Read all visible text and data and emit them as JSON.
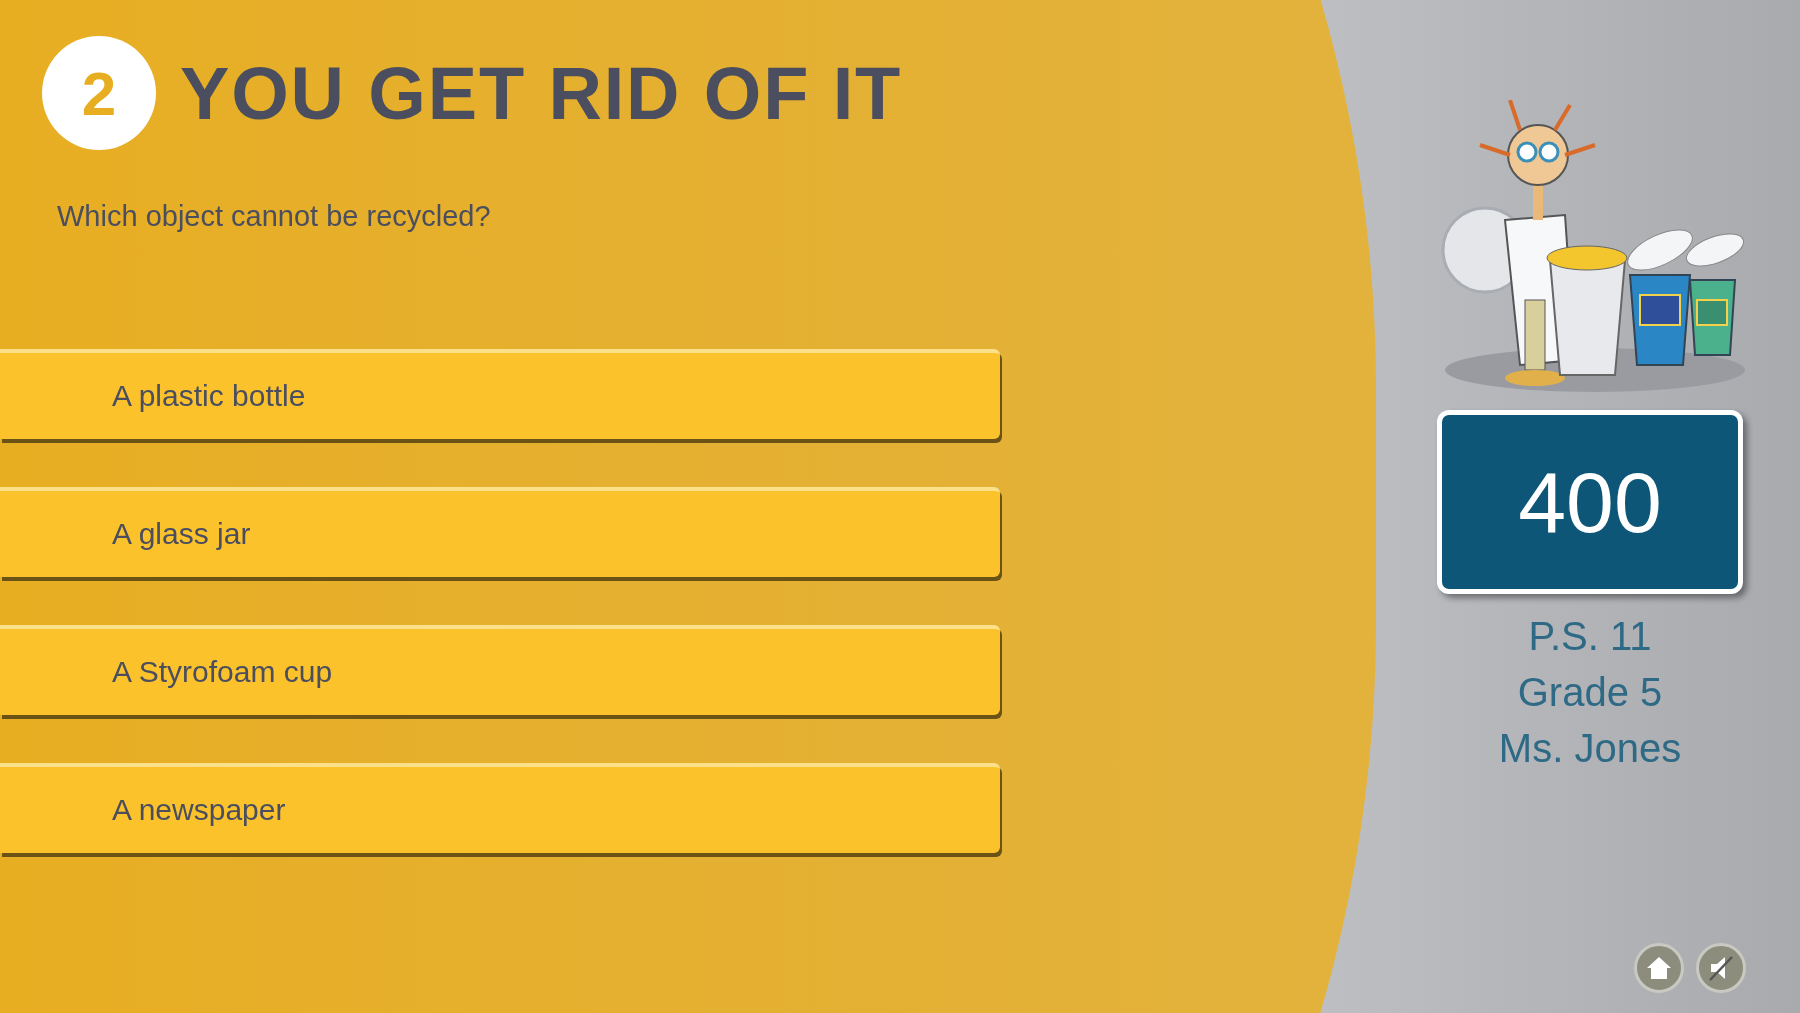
{
  "question": {
    "number": "2",
    "title": "YOU GET RID OF IT",
    "text": "Which object cannot be recycled?"
  },
  "answers": [
    {
      "label": "A plastic bottle"
    },
    {
      "label": "A glass jar"
    },
    {
      "label": "A Styrofoam cup"
    },
    {
      "label": "A newspaper"
    }
  ],
  "score": "400",
  "team": [
    "P.S. 11",
    "Grade 5",
    "Ms. Jones"
  ]
}
